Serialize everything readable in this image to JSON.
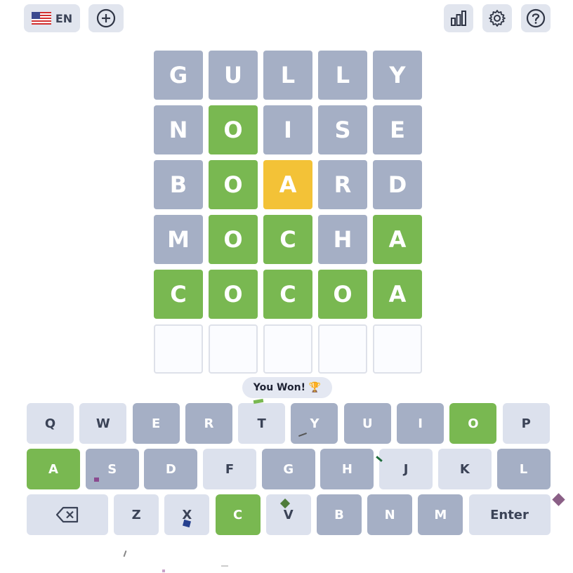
{
  "header": {
    "language_code": "EN",
    "flag_icon": "us-flag-icon",
    "add_icon": "plus-circle-icon",
    "stats_icon": "bar-chart-icon",
    "settings_icon": "gear-icon",
    "help_icon": "question-circle-icon"
  },
  "board": {
    "rows": [
      {
        "letters": [
          "G",
          "U",
          "L",
          "L",
          "Y"
        ],
        "states": [
          "absent",
          "absent",
          "absent",
          "absent",
          "absent"
        ]
      },
      {
        "letters": [
          "N",
          "O",
          "I",
          "S",
          "E"
        ],
        "states": [
          "absent",
          "correct",
          "absent",
          "absent",
          "absent"
        ]
      },
      {
        "letters": [
          "B",
          "O",
          "A",
          "R",
          "D"
        ],
        "states": [
          "absent",
          "correct",
          "present",
          "absent",
          "absent"
        ]
      },
      {
        "letters": [
          "M",
          "O",
          "C",
          "H",
          "A"
        ],
        "states": [
          "absent",
          "correct",
          "correct",
          "absent",
          "correct"
        ]
      },
      {
        "letters": [
          "C",
          "O",
          "C",
          "O",
          "A"
        ],
        "states": [
          "correct",
          "correct",
          "correct",
          "correct",
          "correct"
        ]
      },
      {
        "letters": [
          "",
          "",
          "",
          "",
          ""
        ],
        "states": [
          "empty",
          "empty",
          "empty",
          "empty",
          "empty"
        ]
      }
    ]
  },
  "toast": {
    "text": "You Won! 🏆"
  },
  "keyboard": {
    "rows": [
      [
        {
          "label": "Q",
          "state": "unused"
        },
        {
          "label": "W",
          "state": "unused"
        },
        {
          "label": "E",
          "state": "absent"
        },
        {
          "label": "R",
          "state": "absent"
        },
        {
          "label": "T",
          "state": "unused"
        },
        {
          "label": "Y",
          "state": "absent"
        },
        {
          "label": "U",
          "state": "absent"
        },
        {
          "label": "I",
          "state": "absent"
        },
        {
          "label": "O",
          "state": "correct"
        },
        {
          "label": "P",
          "state": "unused"
        }
      ],
      [
        {
          "label": "A",
          "state": "correct"
        },
        {
          "label": "S",
          "state": "absent"
        },
        {
          "label": "D",
          "state": "absent"
        },
        {
          "label": "F",
          "state": "unused"
        },
        {
          "label": "G",
          "state": "absent"
        },
        {
          "label": "H",
          "state": "absent"
        },
        {
          "label": "J",
          "state": "unused"
        },
        {
          "label": "K",
          "state": "unused"
        },
        {
          "label": "L",
          "state": "absent"
        }
      ],
      [
        {
          "label": "",
          "state": "unused",
          "icon": "backspace-icon",
          "wide": true
        },
        {
          "label": "Z",
          "state": "unused"
        },
        {
          "label": "X",
          "state": "unused"
        },
        {
          "label": "C",
          "state": "correct"
        },
        {
          "label": "V",
          "state": "unused"
        },
        {
          "label": "B",
          "state": "absent"
        },
        {
          "label": "N",
          "state": "absent"
        },
        {
          "label": "M",
          "state": "absent"
        },
        {
          "label": "Enter",
          "state": "unused",
          "wide": true
        }
      ]
    ]
  },
  "colors": {
    "correct": "#79b851",
    "present": "#f3c237",
    "absent": "#a5afc5",
    "unused_key": "#dce1ed"
  }
}
